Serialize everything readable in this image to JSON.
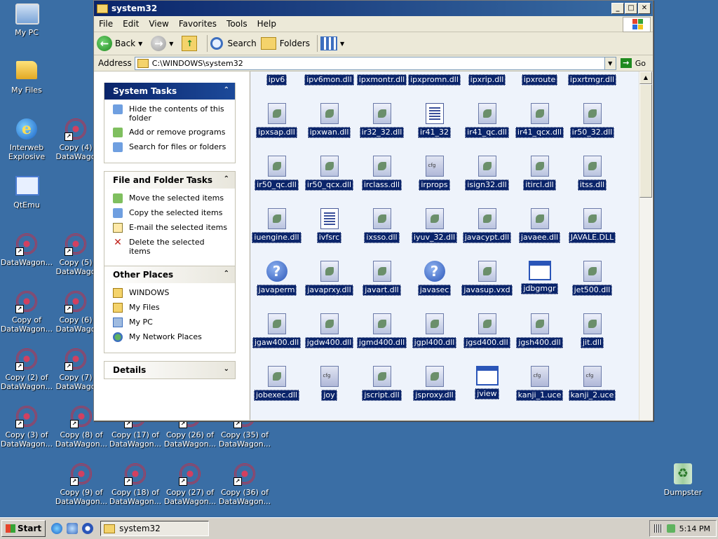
{
  "desktop": {
    "icons": [
      {
        "label": "My PC"
      },
      {
        "label": "My Files"
      },
      {
        "label": "Interweb\nExplosive"
      },
      {
        "label": "QtEmu"
      },
      {
        "label": "DataWagon..."
      },
      {
        "label": "Copy of\nDataWagon..."
      },
      {
        "label": "Copy (2) of\nDataWagon..."
      },
      {
        "label": "Copy (3) of\nDataWagon..."
      },
      {
        "label": "Copy (4)\nDataWago"
      },
      {
        "label": "Copy (5)\nDataWago"
      },
      {
        "label": "Copy (6)\nDataWago"
      },
      {
        "label": "Copy (7)\nDataWago"
      },
      {
        "label": "Copy (8) of\nDataWagon..."
      },
      {
        "label": "Copy (9) of\nDataWagon..."
      },
      {
        "label": "Copy (17) of\nDataWagon..."
      },
      {
        "label": "Copy (18) of\nDataWagon..."
      },
      {
        "label": "Copy (26) of\nDataWagon..."
      },
      {
        "label": "Copy (27) of\nDataWagon..."
      },
      {
        "label": "Copy (35) of\nDataWagon..."
      },
      {
        "label": "Copy (36) of\nDataWagon..."
      },
      {
        "label": "Dumpster"
      }
    ]
  },
  "window": {
    "title": "system32",
    "menu": [
      "File",
      "Edit",
      "View",
      "Favorites",
      "Tools",
      "Help"
    ],
    "toolbar": {
      "back": "Back",
      "search": "Search",
      "folders": "Folders"
    },
    "address": {
      "label": "Address",
      "value": "C:\\WINDOWS\\system32",
      "go": "Go"
    }
  },
  "taskpane": {
    "system_tasks": {
      "title": "System Tasks",
      "items": [
        "Hide the contents of this folder",
        "Add or remove programs",
        "Search for files or folders"
      ]
    },
    "file_tasks": {
      "title": "File and Folder Tasks",
      "items": [
        "Move the selected items",
        "Copy the selected items",
        "E-mail the selected items",
        "Delete the selected items"
      ]
    },
    "other_places": {
      "title": "Other Places",
      "items": [
        "WINDOWS",
        "My Files",
        "My PC",
        "My Network Places"
      ]
    },
    "details": {
      "title": "Details"
    }
  },
  "files": [
    {
      "name": "ipv6",
      "icon": "dll"
    },
    {
      "name": "ipv6mon.dll",
      "icon": "dll"
    },
    {
      "name": "ipxmontr.dll",
      "icon": "dll"
    },
    {
      "name": "ipxpromn.dll",
      "icon": "dll"
    },
    {
      "name": "ipxrip.dll",
      "icon": "dll"
    },
    {
      "name": "ipxroute",
      "icon": "dll"
    },
    {
      "name": "ipxrtmgr.dll",
      "icon": "dll"
    },
    {
      "name": "ipxsap.dll",
      "icon": "dll"
    },
    {
      "name": "ipxwan.dll",
      "icon": "dll"
    },
    {
      "name": "ir32_32.dll",
      "icon": "dll"
    },
    {
      "name": "ir41_32",
      "icon": "doc"
    },
    {
      "name": "ir41_qc.dll",
      "icon": "dll"
    },
    {
      "name": "ir41_qcx.dll",
      "icon": "dll"
    },
    {
      "name": "ir50_32.dll",
      "icon": "dll"
    },
    {
      "name": "ir50_qc.dll",
      "icon": "dll"
    },
    {
      "name": "ir50_qcx.dll",
      "icon": "dll"
    },
    {
      "name": "irclass.dll",
      "icon": "dll"
    },
    {
      "name": "irprops",
      "icon": "cfg"
    },
    {
      "name": "isign32.dll",
      "icon": "dll"
    },
    {
      "name": "itircl.dll",
      "icon": "dll"
    },
    {
      "name": "itss.dll",
      "icon": "dll"
    },
    {
      "name": "iuengine.dll",
      "icon": "dll"
    },
    {
      "name": "ivfsrc",
      "icon": "doc"
    },
    {
      "name": "ixsso.dll",
      "icon": "dll"
    },
    {
      "name": "iyuv_32.dll",
      "icon": "dll"
    },
    {
      "name": "javacypt.dll",
      "icon": "dll"
    },
    {
      "name": "javaee.dll",
      "icon": "dll"
    },
    {
      "name": "JAVALE.DLL",
      "icon": "dll"
    },
    {
      "name": "javaperm",
      "icon": "q"
    },
    {
      "name": "javaprxy.dll",
      "icon": "dll"
    },
    {
      "name": "javart.dll",
      "icon": "dll"
    },
    {
      "name": "javasec",
      "icon": "q"
    },
    {
      "name": "javasup.vxd",
      "icon": "dll"
    },
    {
      "name": "jdbgmgr",
      "icon": "win"
    },
    {
      "name": "jet500.dll",
      "icon": "dll"
    },
    {
      "name": "jgaw400.dll",
      "icon": "dll"
    },
    {
      "name": "jgdw400.dll",
      "icon": "dll"
    },
    {
      "name": "jgmd400.dll",
      "icon": "dll"
    },
    {
      "name": "jgpl400.dll",
      "icon": "dll"
    },
    {
      "name": "jgsd400.dll",
      "icon": "dll"
    },
    {
      "name": "jgsh400.dll",
      "icon": "dll"
    },
    {
      "name": "jit.dll",
      "icon": "dll"
    },
    {
      "name": "jobexec.dll",
      "icon": "dll"
    },
    {
      "name": "joy",
      "icon": "cfg"
    },
    {
      "name": "jscript.dll",
      "icon": "dll"
    },
    {
      "name": "jsproxy.dll",
      "icon": "dll"
    },
    {
      "name": "jview",
      "icon": "win"
    },
    {
      "name": "kanji_1.uce",
      "icon": "cfg"
    },
    {
      "name": "kanji_2.uce",
      "icon": "cfg"
    }
  ],
  "taskbar": {
    "start": "Start",
    "task": "system32",
    "clock": "5:14 PM"
  }
}
